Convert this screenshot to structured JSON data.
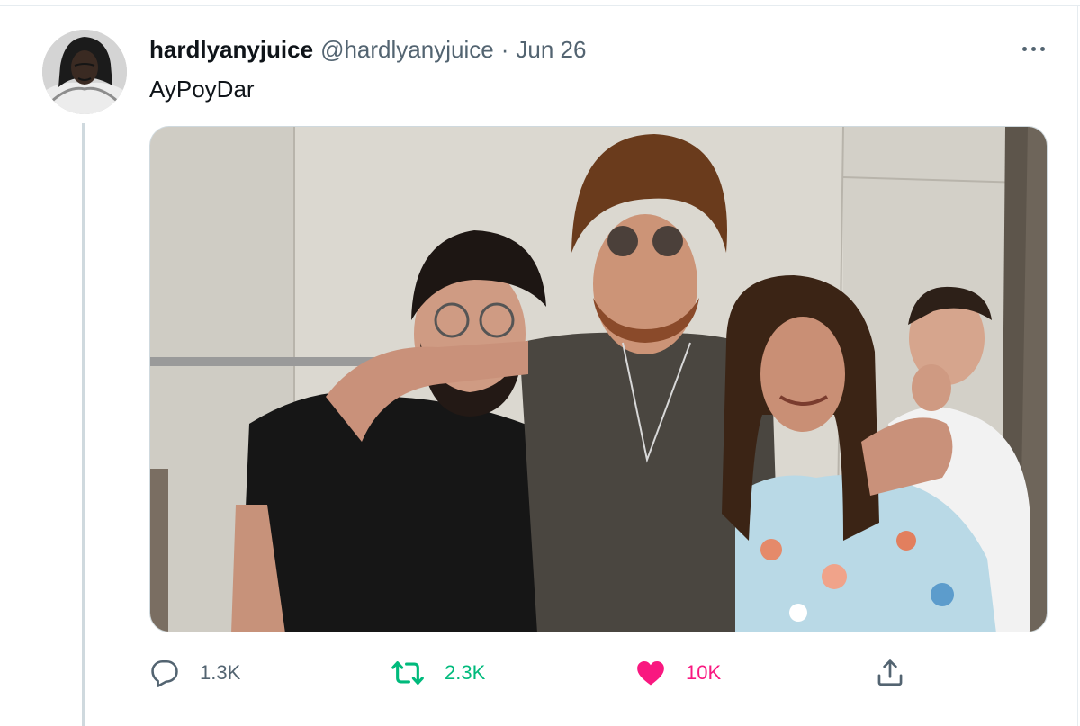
{
  "tweet": {
    "display_name": "hardlyanyjuice",
    "handle": "@hardlyanyjuice",
    "separator": "·",
    "date": "Jun 26",
    "text": "AyPoyDar",
    "more_icon": "more-horizontal-icon"
  },
  "actions": {
    "replies": {
      "icon": "reply-icon",
      "count": "1.3K"
    },
    "retweets": {
      "icon": "retweet-icon",
      "count": "2.3K",
      "active": true
    },
    "likes": {
      "icon": "heart-icon",
      "count": "10K",
      "active": true
    },
    "share": {
      "icon": "share-icon"
    }
  },
  "colors": {
    "text_primary": "#0f1419",
    "text_secondary": "#536471",
    "retweet_green": "#00ba7c",
    "like_pink": "#f91880",
    "border": "#cfd9de"
  }
}
